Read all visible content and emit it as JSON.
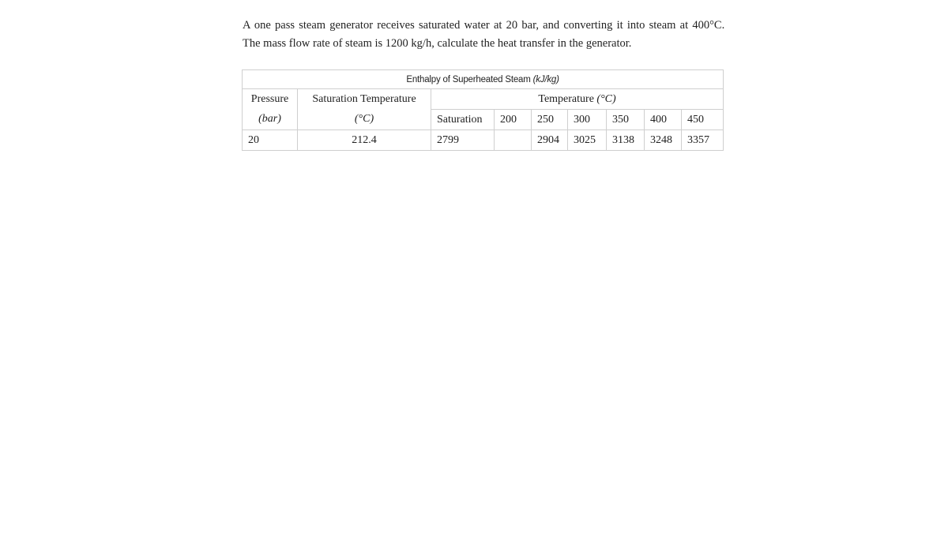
{
  "problem": {
    "line1": "A one pass steam generator receives saturated water at 20 bar, and converting it into steam at 400°C.",
    "line2": "The mass flow rate of steam is 1200 kg/h, calculate the heat transfer in the generator."
  },
  "table": {
    "caption": "Enthalpy of Superheated Steam",
    "caption_unit": "(kJ/kg)",
    "headers": {
      "pressure": "Pressure",
      "pressure_unit": "(bar)",
      "sat_temp": "Saturation Temperature",
      "sat_temp_unit": "(°C)",
      "temperature_group": "Temperature",
      "temperature_group_unit": "(°C)",
      "columns": [
        "Saturation",
        "200",
        "250",
        "300",
        "350",
        "400",
        "450"
      ]
    },
    "rows": [
      {
        "pressure": "20",
        "sat_temp": "212.4",
        "values": [
          "2799",
          "",
          "2904",
          "3025",
          "3138",
          "3248",
          "3357"
        ]
      }
    ]
  }
}
